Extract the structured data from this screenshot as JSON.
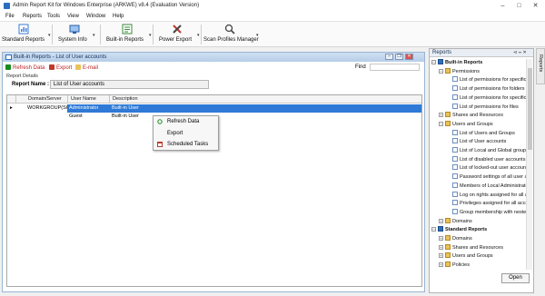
{
  "window": {
    "title": "Admin Report Kit for Windows Enterprise (ARKWE) v8.4 (Evaluation Version)",
    "minimize": "–",
    "maximize": "□",
    "close": "✕"
  },
  "menu": [
    "File",
    "Reports",
    "Tools",
    "View",
    "Window",
    "Help"
  ],
  "toolbar": [
    {
      "label": "Standard Reports",
      "icon": "reports-icon",
      "color": "#3a7bd5"
    },
    {
      "label": "System Info",
      "icon": "system-info-icon",
      "color": "#2a5fa8"
    },
    {
      "label": "Built-in Reports",
      "icon": "built-in-reports-icon",
      "color": "#3a8a3a"
    },
    {
      "label": "Power Export",
      "icon": "power-export-icon",
      "color": "#c0392b"
    },
    {
      "label": "Scan Profiles Manager",
      "icon": "scan-profiles-icon",
      "color": "#444444"
    }
  ],
  "child_window": {
    "title": "Built-in Reports - List of User accounts",
    "actions": [
      {
        "label": "Refresh Data",
        "color": "#1b8a1b"
      },
      {
        "label": "Export",
        "color": "#c0392b"
      },
      {
        "label": "E-mail",
        "color": "#c0392b"
      }
    ],
    "find_label": "Find",
    "report_details_label": "Report Details",
    "report_name_label": "Report Name :",
    "report_name_value": "List of User accounts",
    "grid": {
      "columns": [
        "Domain/Server",
        "User Name",
        "Description"
      ],
      "rows": [
        {
          "marker": "▸",
          "domain": "WORKGROUP(SOFT",
          "user": "Administrator",
          "description": "Built-in User"
        },
        {
          "marker": "",
          "domain": "",
          "user": "Guest",
          "description": "Built-in User"
        }
      ]
    },
    "context_menu": [
      "Refresh Data",
      "Export",
      "Scheduled Tasks"
    ]
  },
  "reports_panel": {
    "title": "Reports",
    "tab_label": "Reports",
    "open_button": "Open",
    "tree": [
      {
        "label": "Built-in Reports",
        "level": 0,
        "bold": true,
        "exp": "−",
        "icon": "root"
      },
      {
        "label": "Permissions",
        "level": 1,
        "exp": "−",
        "icon": "folder"
      },
      {
        "label": "List of permissions for specific",
        "level": 2,
        "icon": "doc"
      },
      {
        "label": "List of permissions for folders",
        "level": 2,
        "icon": "doc"
      },
      {
        "label": "List of permissions for specific",
        "level": 2,
        "icon": "doc"
      },
      {
        "label": "List of permissions for files",
        "level": 2,
        "icon": "doc"
      },
      {
        "label": "Shares and Resources",
        "level": 1,
        "exp": "+",
        "icon": "folder"
      },
      {
        "label": "Users and Groups",
        "level": 1,
        "exp": "−",
        "icon": "folder"
      },
      {
        "label": "List of Users and Groups",
        "level": 2,
        "icon": "doc"
      },
      {
        "label": "List of User accounts",
        "level": 2,
        "icon": "doc"
      },
      {
        "label": "List of Local and Global groups",
        "level": 2,
        "icon": "doc"
      },
      {
        "label": "List of disabled user accounts",
        "level": 2,
        "icon": "doc"
      },
      {
        "label": "List of locked-out user accounts",
        "level": 2,
        "icon": "doc"
      },
      {
        "label": "Password settings of all user a",
        "level": 2,
        "icon": "doc"
      },
      {
        "label": "Members of Local Administrators",
        "level": 2,
        "icon": "doc"
      },
      {
        "label": "Log on rights assigned for all a",
        "level": 2,
        "icon": "doc"
      },
      {
        "label": "Privileges assigned for all acco",
        "level": 2,
        "icon": "doc"
      },
      {
        "label": "Group membership with nested",
        "level": 2,
        "icon": "doc"
      },
      {
        "label": "Domains",
        "level": 1,
        "exp": "+",
        "icon": "folder"
      },
      {
        "label": "Standard Reports",
        "level": 0,
        "bold": true,
        "exp": "−",
        "icon": "root"
      },
      {
        "label": "Domains",
        "level": 1,
        "exp": "+",
        "icon": "folder"
      },
      {
        "label": "Shares and Resources",
        "level": 1,
        "exp": "+",
        "icon": "folder"
      },
      {
        "label": "Users and Groups",
        "level": 1,
        "exp": "+",
        "icon": "folder"
      },
      {
        "label": "Policies",
        "level": 1,
        "exp": "+",
        "icon": "folder"
      }
    ]
  }
}
